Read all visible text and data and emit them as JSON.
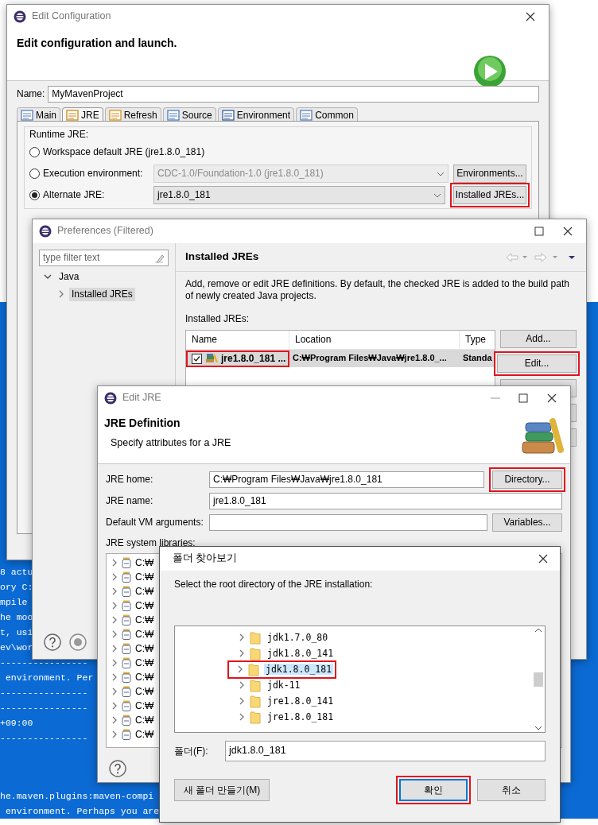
{
  "console": {
    "lines": [
      "8 actu",
      "ory C:",
      "mpile",
      "he moo",
      "t, usi",
      "ev\\wor",
      "----------------",
      " environment. Per",
      "----------------",
      "----------------",
      "+09:00",
      "----------------",
      "he.maven.plugins:maven-compi",
      " environment. Perhaps you are"
    ]
  },
  "edit_configuration": {
    "title": "Edit Configuration",
    "heading": "Edit configuration and launch.",
    "name_label": "Name:",
    "name_value": "MyMavenProject",
    "tabs": [
      {
        "label": "Main",
        "selected": false
      },
      {
        "label": "JRE",
        "selected": true
      },
      {
        "label": "Refresh",
        "selected": false
      },
      {
        "label": "Source",
        "selected": false
      },
      {
        "label": "Environment",
        "selected": false
      },
      {
        "label": "Common",
        "selected": false
      }
    ],
    "group_label": "Runtime JRE:",
    "options": [
      {
        "label": "Workspace default JRE (jre1.8.0_181)",
        "selected": false
      },
      {
        "label": "Execution environment:",
        "selected": false,
        "combo": "CDC-1.0/Foundation-1.0 (jre1.8.0_181)",
        "combo_disabled": true,
        "button": "Environments...",
        "highlighted": false
      },
      {
        "label": "Alternate JRE:",
        "selected": true,
        "combo": "jre1.8.0_181",
        "combo_disabled": false,
        "button": "Installed JREs...",
        "highlighted": true
      }
    ]
  },
  "preferences": {
    "title": "Preferences (Filtered)",
    "filter_placeholder": "type filter text",
    "tree": [
      {
        "label": "Java",
        "expanded": true,
        "selected": false,
        "children": [
          {
            "label": "Installed JREs",
            "expanded": false,
            "selected": true
          }
        ]
      }
    ],
    "page_title": "Installed JREs",
    "description": "Add, remove or edit JRE definitions. By default, the checked JRE is added to the build path of newly created Java projects.",
    "list_label": "Installed JREs:",
    "columns": [
      "Name",
      "Location",
      "Type"
    ],
    "rows": [
      {
        "checked": true,
        "highlighted": true,
        "cells": [
          "jre1.8.0_181 ...",
          "C:₩Program Files₩Java₩jre1.8.0_...",
          "Standa"
        ]
      }
    ],
    "buttons": [
      {
        "label": "Add...",
        "highlighted": false
      },
      {
        "label": "Edit...",
        "highlighted": true
      }
    ]
  },
  "edit_jre": {
    "title": "Edit JRE",
    "heading": "JRE Definition",
    "subheading": "Specify attributes for a JRE",
    "fields": [
      {
        "label": "JRE home:",
        "value": "C:₩Program Files₩Java₩jre1.8.0_181",
        "button": "Directory...",
        "highlighted": true
      },
      {
        "label": "JRE name:",
        "value": "jre1.8.0_181"
      },
      {
        "label": "Default VM arguments:",
        "button": "Variables...",
        "highlighted": false
      }
    ],
    "libraries_label": "JRE system libraries:",
    "libraries": [
      "C:₩",
      "C:₩",
      "C:₩",
      "C:₩",
      "C:₩",
      "C:₩",
      "C:₩",
      "C:₩",
      "C:₩",
      "C:₩",
      "C:₩",
      "C:₩",
      "C:₩"
    ]
  },
  "folder_dialog": {
    "title": "폴더 찾아보기",
    "prompt": "Select the root directory of the JRE installation:",
    "folders": [
      {
        "label": "jdk1.7.0_80",
        "selected": false,
        "highlighted": false
      },
      {
        "label": "jdk1.8.0_141",
        "selected": false,
        "highlighted": false
      },
      {
        "label": "jdk1.8.0_181",
        "selected": true,
        "highlighted": true
      },
      {
        "label": "jdk-11",
        "selected": false,
        "highlighted": false
      },
      {
        "label": "jre1.8.0_141",
        "selected": false,
        "highlighted": false
      },
      {
        "label": "jre1.8.0_181",
        "selected": false,
        "highlighted": false
      }
    ],
    "folder_label": "폴더(F):",
    "folder_value": "jdk1.8.0_181",
    "buttons": [
      {
        "label": "새 폴더 만들기(M)",
        "default": false,
        "highlighted": false
      },
      {
        "label": "확인",
        "default": true,
        "highlighted": true
      },
      {
        "label": "취소",
        "default": false,
        "highlighted": false
      }
    ]
  }
}
